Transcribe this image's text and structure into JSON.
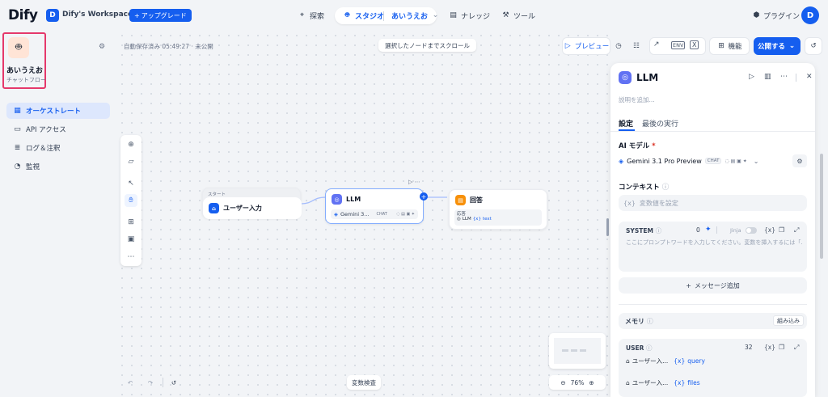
{
  "header": {
    "logo": "Dify",
    "workspace_initial": "D",
    "workspace_name": "Dify's Workspace",
    "upgrade_label": "アップグレード",
    "nav": {
      "explore": "探索",
      "studio": "スタジオ",
      "app_name": "あいうえお",
      "knowledge": "ナレッジ",
      "tools": "ツール"
    },
    "plugins": "プラグイン",
    "avatar_initial": "D"
  },
  "sidebar": {
    "app_name": "あいうえお",
    "app_type": "チャットフロー",
    "items": [
      {
        "label": "オーケストレート",
        "icon": "orchestrate-icon"
      },
      {
        "label": "API アクセス",
        "icon": "terminal-icon"
      },
      {
        "label": "ログ＆注釈",
        "icon": "log-icon"
      },
      {
        "label": "監視",
        "icon": "monitor-icon"
      }
    ]
  },
  "canvas": {
    "autosave": "自動保存済み 05:49:27 · 未公開",
    "scroll_button": "選択したノードまでスクロール",
    "variable_inspect": "変数検査",
    "zoom": "76%",
    "nodes": {
      "start": {
        "tag": "スタート",
        "title": "ユーザー入力"
      },
      "llm": {
        "title": "LLM",
        "model": "Gemini 3...",
        "mode": "CHAT"
      },
      "answer": {
        "title": "回答",
        "sub_label": "応答",
        "var_node": "LLM",
        "var_name": "text"
      }
    }
  },
  "toolbar": {
    "preview": "プレビュー",
    "features": "機能",
    "publish": "公開する"
  },
  "panel": {
    "title": "LLM",
    "description_placeholder": "説明を追加...",
    "tabs": [
      "設定",
      "最後の実行"
    ],
    "ai_model_label": "AI モデル",
    "model_name": "Gemini 3.1 Pro Preview",
    "model_mode": "CHAT",
    "context_label": "コンテキスト",
    "context_placeholder": "変数値を設定",
    "system_label": "SYSTEM",
    "system_count": "0",
    "jinja": "Jinja",
    "system_placeholder": "ここにプロンプトワードを入力してください。変数を挿入するには「...",
    "add_message": "メッセージ追加",
    "memory_label": "メモリ",
    "memory_builtin": "組み込み",
    "user_label": "USER",
    "user_count": "32",
    "user_var_node": "ユーザー入...",
    "user_var_query": "query",
    "user_var_files": "files"
  },
  "colors": {
    "accent": "#155eef",
    "highlight_border": "#e5386b",
    "canvas_bg": "#f2f4f7"
  }
}
